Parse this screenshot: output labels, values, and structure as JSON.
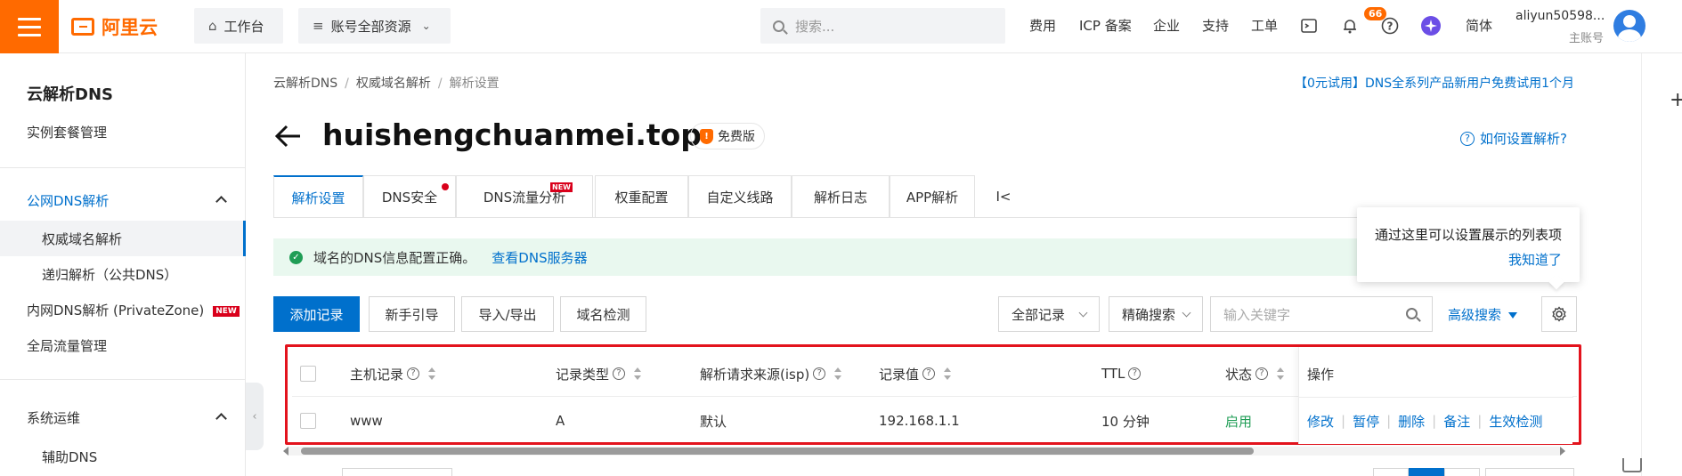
{
  "topbar": {
    "logo_text": "阿里云",
    "workbench": "工作台",
    "resources": "账号全部资源",
    "search_placeholder": "搜索...",
    "nav": [
      "费用",
      "ICP 备案",
      "企业",
      "支持",
      "工单"
    ],
    "notify_count": "66",
    "lang": "简体",
    "account_name": "aliyun50598...",
    "account_role": "主账号",
    "accent_color": "#ff6a00"
  },
  "sidebar": {
    "title": "云解析DNS",
    "instance_mgmt": "实例套餐管理",
    "public_dns": "公网DNS解析",
    "authoritative": "权威域名解析",
    "recursive": "递归解析（公共DNS）",
    "private_zone": "内网DNS解析 (PrivateZone)",
    "new_tag": "NEW",
    "global_traffic": "全局流量管理",
    "ops": "系统运维",
    "aux_dns": "辅助DNS"
  },
  "main": {
    "breadcrumb": [
      "云解析DNS",
      "权威域名解析",
      "解析设置"
    ],
    "promo": "【0元试用】DNS全系列产品新用户免费试用1个月",
    "domain": "huishengchuanmei.top",
    "edition": "免费版",
    "help": "如何设置解析?",
    "tabs": [
      "解析设置",
      "DNS安全",
      "DNS流量分析",
      "权重配置",
      "自定义线路",
      "解析日志",
      "APP解析",
      "I<"
    ],
    "tab_new": "NEW",
    "notice_text": "域名的DNS信息配置正确。",
    "notice_link": "查看DNS服务器",
    "tooltip_text": "通过这里可以设置展示的列表项",
    "tooltip_ok": "我知道了",
    "buttons": {
      "add": "添加记录",
      "guide": "新手引导",
      "import_export": "导入/导出",
      "check": "域名检测"
    },
    "filter_all": "全部记录",
    "filter_exact": "精确搜索",
    "keyword_placeholder": "输入关键字",
    "advanced_search": "高级搜索",
    "primary_color": "#0070cc"
  },
  "table": {
    "columns": [
      "主机记录",
      "记录类型",
      "解析请求来源(isp)",
      "记录值",
      "TTL",
      "状态",
      "操作"
    ],
    "rows": [
      {
        "host": "www",
        "type": "A",
        "isp": "默认",
        "value": "192.168.1.1",
        "ttl": "10 分钟",
        "status": "启用",
        "actions": [
          "修改",
          "暂停",
          "删除",
          "备注",
          "生效检测"
        ]
      }
    ]
  }
}
